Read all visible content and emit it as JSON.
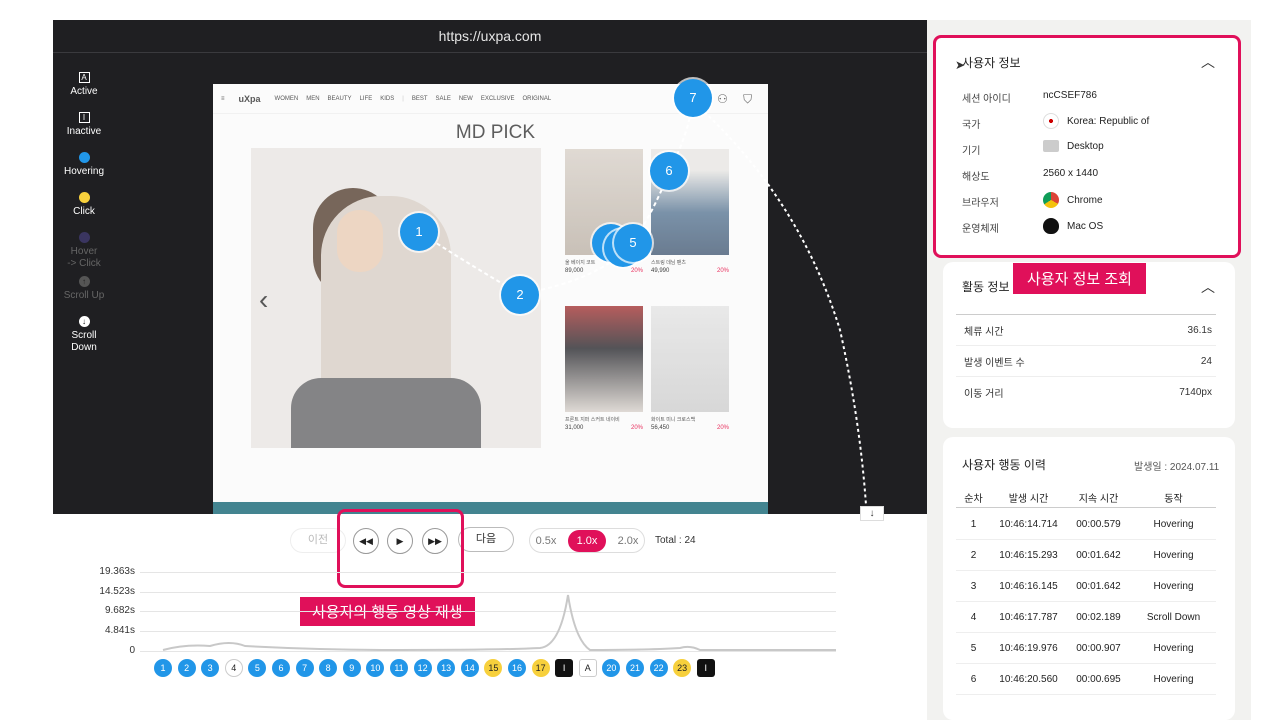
{
  "replay": {
    "url": "https://uxpa.com",
    "legend": [
      {
        "icon": "A",
        "label": "Active"
      },
      {
        "icon": "I",
        "label": "Inactive"
      },
      {
        "label": "Hovering",
        "color": "#2196e8"
      },
      {
        "label": "Click",
        "color": "#f7d03c"
      },
      {
        "label": "Hover\n-> Click",
        "color": "#3a3560"
      },
      {
        "label": "Scroll Up"
      },
      {
        "label": "Scroll\nDown"
      }
    ]
  },
  "site": {
    "logo": "uXpa",
    "nav": [
      "WOMEN",
      "MEN",
      "BEAUTY",
      "LIFE",
      "KIDS",
      "BEST",
      "SALE",
      "NEW",
      "EXCLUSIVE",
      "ORIGINAL"
    ],
    "title": "MD PICK",
    "products": [
      {
        "name": "울 베이지 코트",
        "price": "89,000",
        "discount": "20%"
      },
      {
        "name": "스트링 데님 팬츠",
        "price": "49,990",
        "discount": "20%"
      },
      {
        "name": "프론트 지퍼 스커트 네이비",
        "price": "31,000",
        "discount": "20%"
      },
      {
        "name": "화이트 미니 크로스백",
        "price": "56,450",
        "discount": "20%"
      }
    ]
  },
  "markers": [
    "1",
    "2",
    "5",
    "6",
    "7"
  ],
  "controls": {
    "prev": "이전",
    "next": "다음",
    "speeds": [
      "0.5x",
      "1.0x",
      "2.0x"
    ],
    "active_speed": "1.0x",
    "total": "Total : 24"
  },
  "annotations": {
    "user_info": "사용자 정보 조회",
    "replay": "사용자의 행동 영상 재생"
  },
  "timeline": {
    "y_ticks": [
      "19.363s",
      "14.523s",
      "9.682s",
      "4.841s",
      "0"
    ],
    "events": [
      {
        "label": "1",
        "kind": "h"
      },
      {
        "label": "2",
        "kind": "h"
      },
      {
        "label": "3",
        "kind": "h"
      },
      {
        "label": "4",
        "kind": "o"
      },
      {
        "label": "5",
        "kind": "h"
      },
      {
        "label": "6",
        "kind": "h"
      },
      {
        "label": "7",
        "kind": "h"
      },
      {
        "label": "8",
        "kind": "h"
      },
      {
        "label": "9",
        "kind": "h"
      },
      {
        "label": "10",
        "kind": "h"
      },
      {
        "label": "11",
        "kind": "h"
      },
      {
        "label": "12",
        "kind": "h"
      },
      {
        "label": "13",
        "kind": "h"
      },
      {
        "label": "14",
        "kind": "h"
      },
      {
        "label": "15",
        "kind": "c"
      },
      {
        "label": "16",
        "kind": "h"
      },
      {
        "label": "17",
        "kind": "c"
      },
      {
        "label": "I",
        "kind": "i"
      },
      {
        "label": "A",
        "kind": "a"
      },
      {
        "label": "20",
        "kind": "h"
      },
      {
        "label": "21",
        "kind": "h"
      },
      {
        "label": "22",
        "kind": "h"
      },
      {
        "label": "23",
        "kind": "c"
      },
      {
        "label": "I",
        "kind": "i"
      }
    ]
  },
  "user_info": {
    "title": "사용자 정보",
    "rows": [
      {
        "key": "세션 아이디",
        "value": "ncCSEF786"
      },
      {
        "key": "국가",
        "value": "Korea: Republic of",
        "icon": "korea-flag-icon"
      },
      {
        "key": "기기",
        "value": "Desktop",
        "icon": "monitor-icon"
      },
      {
        "key": "해상도",
        "value": "2560 x 1440"
      },
      {
        "key": "브라우저",
        "value": "Chrome",
        "icon": "chrome-icon"
      },
      {
        "key": "운영체제",
        "value": "Mac OS",
        "icon": "apple-icon"
      }
    ]
  },
  "activity": {
    "title": "활동 정보",
    "rows": [
      {
        "key": "체류 시간",
        "value": "36.1s"
      },
      {
        "key": "발생 이벤트 수",
        "value": "24"
      },
      {
        "key": "이동 거리",
        "value": "7140px"
      }
    ]
  },
  "history": {
    "title": "사용자 행동 이력",
    "date": "발생일 : 2024.07.11",
    "columns": [
      "순차",
      "발생 시간",
      "지속 시간",
      "동작"
    ],
    "rows": [
      [
        "1",
        "10:46:14.714",
        "00:00.579",
        "Hovering"
      ],
      [
        "2",
        "10:46:15.293",
        "00:01.642",
        "Hovering"
      ],
      [
        "3",
        "10:46:16.145",
        "00:01.642",
        "Hovering"
      ],
      [
        "4",
        "10:46:17.787",
        "00:02.189",
        "Scroll Down"
      ],
      [
        "5",
        "10:46:19.976",
        "00:00.907",
        "Hovering"
      ],
      [
        "6",
        "10:46:20.560",
        "00:00.695",
        "Hovering"
      ]
    ]
  }
}
